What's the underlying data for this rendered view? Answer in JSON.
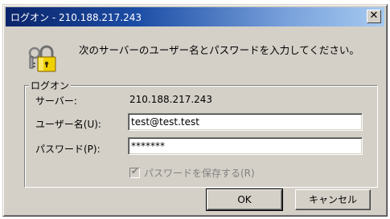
{
  "window": {
    "title": "ログオン - 210.188.217.243",
    "close_label": "✕"
  },
  "dialog": {
    "message": "次のサーバーのユーザー名とパスワードを入力してください。",
    "icon": "lock-keys-icon"
  },
  "group": {
    "legend": "ログオン"
  },
  "server": {
    "label": "サーバー:",
    "value": "210.188.217.243"
  },
  "username": {
    "label": "ユーザー名(U):",
    "value": "test@test.test"
  },
  "password": {
    "label": "パスワード(P):",
    "value": "*******"
  },
  "save_password": {
    "label": "パスワードを保存する(R)",
    "checked": true,
    "enabled": false
  },
  "buttons": {
    "ok": "OK",
    "cancel": "キャンセル"
  },
  "colors": {
    "titlebar_start": "#0a246a",
    "titlebar_end": "#a6caf0",
    "face": "#d4d0c8"
  }
}
